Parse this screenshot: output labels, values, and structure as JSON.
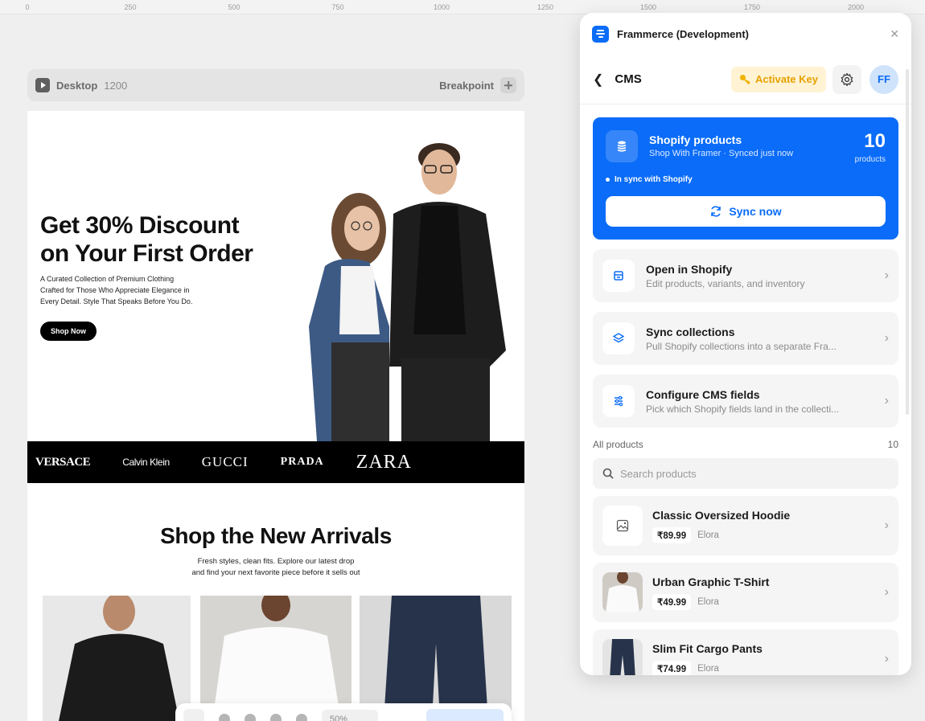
{
  "ruler": [
    "0",
    "250",
    "500",
    "750",
    "1000",
    "1250",
    "1500",
    "1750",
    "2000"
  ],
  "breakpoint": {
    "device": "Desktop",
    "width": "1200",
    "label": "Breakpoint"
  },
  "hero": {
    "title_line1": "Get 30% Discount",
    "title_line2": "on Your First Order",
    "subtitle_line1": "A Curated Collection of Premium Clothing",
    "subtitle_line2": "Crafted for Those Who Appreciate Elegance in",
    "subtitle_line3": "Every Detail. Style That Speaks Before You Do.",
    "button": "Shop Now"
  },
  "brands": [
    "VERSACE",
    "Calvin Klein",
    "GUCCI",
    "PRADA",
    "ZARA"
  ],
  "arrivals": {
    "title": "Shop the New Arrivals",
    "subtitle_line1": "Fresh styles, clean fits. Explore our latest drop",
    "subtitle_line2": "and find your next favorite piece before it sells out"
  },
  "toolbar": {
    "zoom": "50%"
  },
  "panel": {
    "app_title": "Frammerce (Development)",
    "section": "CMS",
    "activate_key": "Activate Key",
    "avatar": "FF",
    "sync_card": {
      "title": "Shopify products",
      "subtitle": "Shop With Framer · Synced just now",
      "count": "10",
      "count_label": "products",
      "status": "In sync with Shopify",
      "button": "Sync now"
    },
    "actions": [
      {
        "title": "Open in Shopify",
        "subtitle": "Edit products, variants, and inventory"
      },
      {
        "title": "Sync collections",
        "subtitle": "Pull Shopify collections into a separate Fra..."
      },
      {
        "title": "Configure CMS fields",
        "subtitle": "Pick which Shopify fields land in the collecti..."
      }
    ],
    "all_products_label": "All products",
    "all_products_count": "10",
    "search_placeholder": "Search products",
    "products": [
      {
        "title": "Classic Oversized Hoodie",
        "price": "₹89.99",
        "vendor": "Elora"
      },
      {
        "title": "Urban Graphic T-Shirt",
        "price": "₹49.99",
        "vendor": "Elora"
      },
      {
        "title": "Slim Fit Cargo Pants",
        "price": "₹74.99",
        "vendor": "Elora"
      }
    ]
  },
  "colors": {
    "accent": "#0a6cf8",
    "key": "#e6a100",
    "brand_bar": "#000000"
  }
}
